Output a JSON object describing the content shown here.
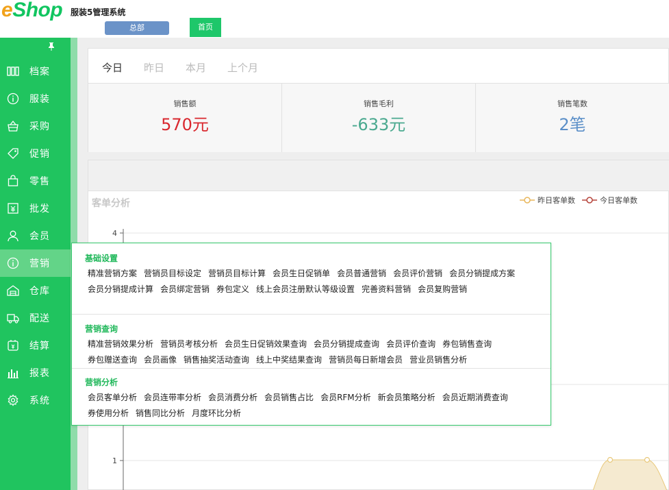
{
  "header": {
    "logo_e": "e",
    "logo_rest": "Shop",
    "system_title": "服装5管理系统",
    "tab_hq": "总部",
    "tab_home": "首页"
  },
  "colors": {
    "brand_green": "#20c45f",
    "logo_orange": "#f1a21b",
    "sales_red": "#d9272e",
    "profit_green": "#4aa98f",
    "count_blue": "#5b8fc8",
    "menu_title_green": "#21b85b"
  },
  "sidebar": {
    "pin_icon": "pin-icon",
    "items": [
      {
        "label": "档案",
        "icon": "archive-icon"
      },
      {
        "label": "服装",
        "icon": "info-circle-icon"
      },
      {
        "label": "采购",
        "icon": "basket-icon"
      },
      {
        "label": "促销",
        "icon": "tag-icon"
      },
      {
        "label": "零售",
        "icon": "shopping-bag-icon"
      },
      {
        "label": "批发",
        "icon": "invoice-icon"
      },
      {
        "label": "会员",
        "icon": "user-icon"
      },
      {
        "label": "营销",
        "icon": "info-circle-icon",
        "active": true
      },
      {
        "label": "仓库",
        "icon": "warehouse-icon"
      },
      {
        "label": "配送",
        "icon": "truck-icon"
      },
      {
        "label": "结算",
        "icon": "settle-icon"
      },
      {
        "label": "报表",
        "icon": "bar-chart-icon"
      },
      {
        "label": "系统",
        "icon": "gear-icon"
      }
    ]
  },
  "period_tabs": [
    "今日",
    "昨日",
    "本月",
    "上个月"
  ],
  "stats": [
    {
      "label": "销售额",
      "value": "570元"
    },
    {
      "label": "销售毛利",
      "value": "-633元"
    },
    {
      "label": "销售笔数",
      "value": "2笔"
    }
  ],
  "chart": {
    "title": "客单分析",
    "legend": [
      "昨日客单数",
      "今日客单数"
    ]
  },
  "chart_data": {
    "type": "line",
    "title": "客单分析",
    "series": [
      {
        "name": "昨日客单数",
        "color": "#e8b65a"
      },
      {
        "name": "今日客单数",
        "color": "#b5433a"
      }
    ],
    "y_ticks": [
      "4",
      "1"
    ],
    "grid": true,
    "legend_position": "top-right"
  },
  "mega_menu": {
    "sections": [
      {
        "title": "基础设置",
        "links": [
          "精准营销方案",
          "营销员目标设定",
          "营销员目标计算",
          "会员生日促销单",
          "会员普通营销",
          "会员评价营销",
          "会员分销提成方案",
          "会员分销提成计算",
          "会员绑定营销",
          "券包定义",
          "线上会员注册默认等级设置",
          "完善资料营销",
          "会员复购营销"
        ]
      },
      {
        "title": "营销查询",
        "links": [
          "精准营销效果分析",
          "营销员考核分析",
          "会员生日促销效果查询",
          "会员分销提成查询",
          "会员评价查询",
          "券包销售查询",
          "券包赠送查询",
          "会员画像",
          "销售抽奖活动查询",
          "线上中奖结果查询",
          "营销员每日新增会员",
          "营业员销售分析"
        ]
      },
      {
        "title": "营销分析",
        "links": [
          "会员客单分析",
          "会员连带率分析",
          "会员消费分析",
          "会员销售占比",
          "会员RFM分析",
          "新会员策略分析",
          "会员近期消费查询",
          "券使用分析",
          "销售同比分析",
          "月度环比分析"
        ]
      }
    ]
  }
}
